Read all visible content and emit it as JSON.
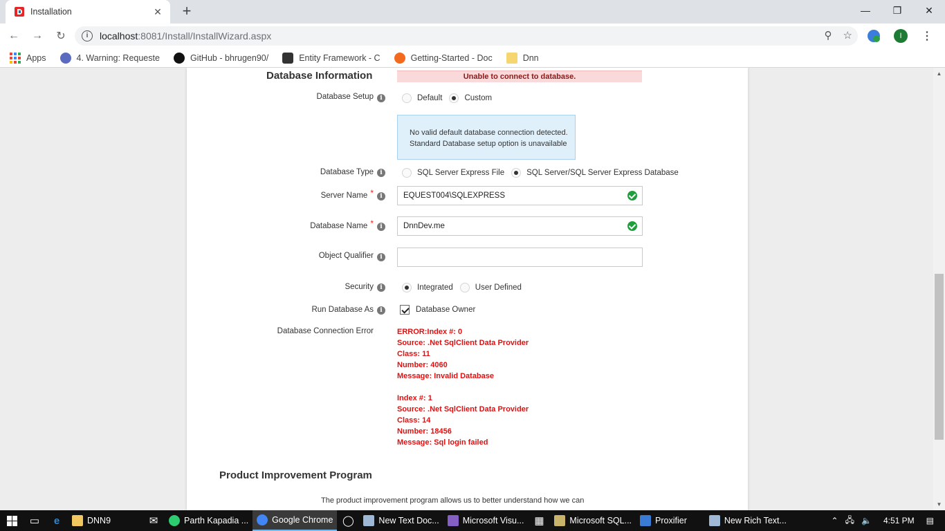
{
  "browser": {
    "tab_title": "Installation",
    "tab_close": "✕",
    "new_tab": "+",
    "url_host": "localhost",
    "url_rest": ":8081/Install/InstallWizard.aspx",
    "profile_initial": "I",
    "window_minimize": "—",
    "window_restore": "❐",
    "window_close": "✕"
  },
  "bookmarks": [
    {
      "label": "Apps"
    },
    {
      "label": "4. Warning: Requeste"
    },
    {
      "label": "GitHub - bhrugen90/"
    },
    {
      "label": "Entity Framework - C"
    },
    {
      "label": "Getting-Started - Doc"
    },
    {
      "label": "Dnn"
    }
  ],
  "page": {
    "section_title": "Database Information",
    "error_banner": "Unable to connect to database.",
    "database_setup": {
      "label": "Database Setup",
      "options": [
        "Default",
        "Custom"
      ],
      "selected": "Custom"
    },
    "info_box": {
      "line1": "No valid default database connection detected.",
      "line2": "Standard Database setup option is unavailable"
    },
    "database_type": {
      "label": "Database Type",
      "options": [
        "SQL Server Express File",
        "SQL Server/SQL Server Express Database"
      ],
      "selected": "SQL Server/SQL Server Express Database"
    },
    "server_name": {
      "label": "Server Name",
      "required": "*",
      "value": "EQUEST004\\SQLEXPRESS"
    },
    "database_name": {
      "label": "Database Name",
      "required": "*",
      "value": "DnnDev.me"
    },
    "object_qualifier": {
      "label": "Object Qualifier",
      "value": ""
    },
    "security": {
      "label": "Security",
      "options": [
        "Integrated",
        "User Defined"
      ],
      "selected": "Integrated"
    },
    "run_database_as": {
      "label": "Run Database As",
      "checkbox_label": "Database Owner",
      "checked": true
    },
    "connection_error": {
      "label": "Database Connection Error",
      "block1": [
        "ERROR:Index #: 0",
        "Source: .Net SqlClient Data Provider",
        "Class: 11",
        "Number: 4060",
        "Message: Invalid Database"
      ],
      "block2": [
        "Index #: 1",
        "Source: .Net SqlClient Data Provider",
        "Class: 14",
        "Number: 18456",
        "Message: Sql login failed"
      ]
    },
    "program": {
      "title": "Product Improvement Program",
      "text": "The product improvement program allows us to better understand how we can"
    }
  },
  "taskbar": {
    "items": [
      {
        "label": "DNN9",
        "color": "#f3c75f"
      },
      {
        "label": "Parth Kapadia ...",
        "color": "#2ecc71"
      },
      {
        "label": "Google Chrome",
        "color": "#4285f4"
      },
      {
        "label": "New Text Doc...",
        "color": "#9fb8d6"
      },
      {
        "label": "Microsoft Visu...",
        "color": "#865fc5"
      },
      {
        "label": "Microsoft SQL...",
        "color": "#c8b46a"
      },
      {
        "label": "Proxifier",
        "color": "#3a7bd5"
      },
      {
        "label": "New Rich Text...",
        "color": "#9fb8d6"
      }
    ],
    "time": "4:51 PM"
  }
}
